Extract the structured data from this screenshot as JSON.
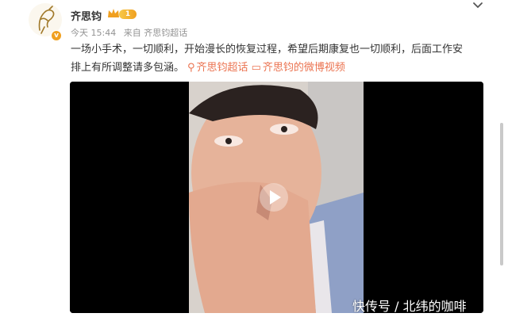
{
  "post": {
    "author": "齐思钧",
    "level": "1",
    "verified_mark": "v",
    "time": "今天 15:44",
    "source": "来自 齐思钧超话",
    "text_line1": "一场小手术，一切顺利，开始漫长的恢复过程，希望后期康复也一切顺利，后面工作安",
    "text_line2": "排上有所调整请多包涵。",
    "link1": "齐思钧超话",
    "link2": "齐思钧的微博视频"
  },
  "video": {
    "watermark": "快传号 / 北纬的咖啡"
  },
  "colors": {
    "link": "#eb7350",
    "meta": "#939393",
    "badge": "#f0a020"
  },
  "icons": [
    "avatar-sketch-icon",
    "crown-icon",
    "chevron-down-icon",
    "location-pin-icon",
    "video-icon",
    "play-icon"
  ]
}
